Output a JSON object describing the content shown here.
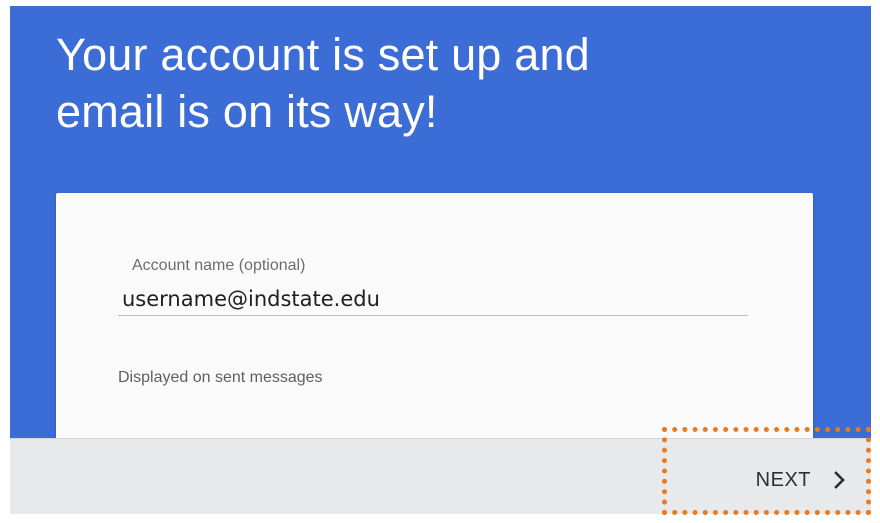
{
  "header": {
    "title_line1": "Your account is set up and",
    "title_line2": "email is on its way!"
  },
  "form": {
    "account_name": {
      "label": "Account name (optional)",
      "value": "username@indstate.edu",
      "helper": "Displayed on sent messages"
    }
  },
  "footer": {
    "next_label": "NEXT",
    "next_icon": "chevron-right-icon"
  },
  "colors": {
    "background_blue": "#3c6cd6",
    "card_background": "#fafafa",
    "bottom_bar": "#e8e9ea",
    "highlight_orange": "#e87a22"
  }
}
